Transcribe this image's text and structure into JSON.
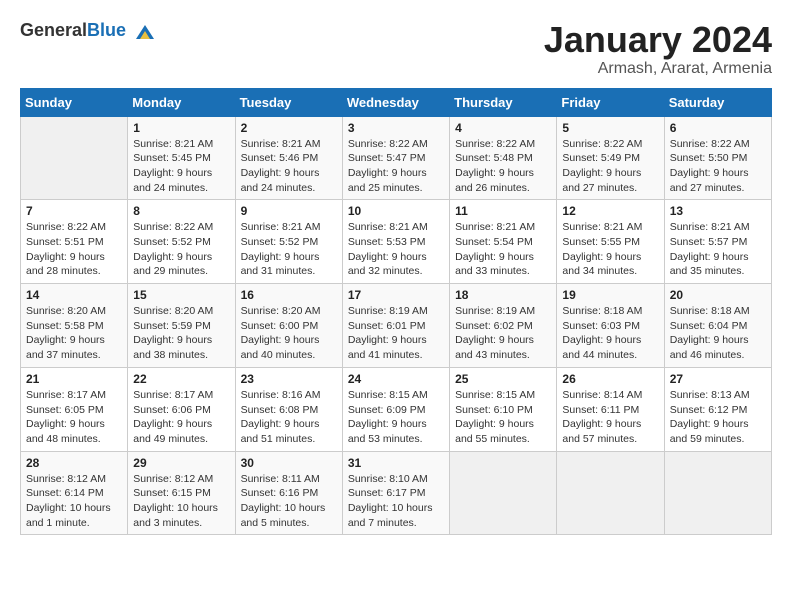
{
  "header": {
    "logo_general": "General",
    "logo_blue": "Blue",
    "month": "January 2024",
    "location": "Armash, Ararat, Armenia"
  },
  "weekdays": [
    "Sunday",
    "Monday",
    "Tuesday",
    "Wednesday",
    "Thursday",
    "Friday",
    "Saturday"
  ],
  "weeks": [
    [
      {
        "day": "",
        "info": ""
      },
      {
        "day": "1",
        "info": "Sunrise: 8:21 AM\nSunset: 5:45 PM\nDaylight: 9 hours\nand 24 minutes."
      },
      {
        "day": "2",
        "info": "Sunrise: 8:21 AM\nSunset: 5:46 PM\nDaylight: 9 hours\nand 24 minutes."
      },
      {
        "day": "3",
        "info": "Sunrise: 8:22 AM\nSunset: 5:47 PM\nDaylight: 9 hours\nand 25 minutes."
      },
      {
        "day": "4",
        "info": "Sunrise: 8:22 AM\nSunset: 5:48 PM\nDaylight: 9 hours\nand 26 minutes."
      },
      {
        "day": "5",
        "info": "Sunrise: 8:22 AM\nSunset: 5:49 PM\nDaylight: 9 hours\nand 27 minutes."
      },
      {
        "day": "6",
        "info": "Sunrise: 8:22 AM\nSunset: 5:50 PM\nDaylight: 9 hours\nand 27 minutes."
      }
    ],
    [
      {
        "day": "7",
        "info": "Sunrise: 8:22 AM\nSunset: 5:51 PM\nDaylight: 9 hours\nand 28 minutes."
      },
      {
        "day": "8",
        "info": "Sunrise: 8:22 AM\nSunset: 5:52 PM\nDaylight: 9 hours\nand 29 minutes."
      },
      {
        "day": "9",
        "info": "Sunrise: 8:21 AM\nSunset: 5:52 PM\nDaylight: 9 hours\nand 31 minutes."
      },
      {
        "day": "10",
        "info": "Sunrise: 8:21 AM\nSunset: 5:53 PM\nDaylight: 9 hours\nand 32 minutes."
      },
      {
        "day": "11",
        "info": "Sunrise: 8:21 AM\nSunset: 5:54 PM\nDaylight: 9 hours\nand 33 minutes."
      },
      {
        "day": "12",
        "info": "Sunrise: 8:21 AM\nSunset: 5:55 PM\nDaylight: 9 hours\nand 34 minutes."
      },
      {
        "day": "13",
        "info": "Sunrise: 8:21 AM\nSunset: 5:57 PM\nDaylight: 9 hours\nand 35 minutes."
      }
    ],
    [
      {
        "day": "14",
        "info": "Sunrise: 8:20 AM\nSunset: 5:58 PM\nDaylight: 9 hours\nand 37 minutes."
      },
      {
        "day": "15",
        "info": "Sunrise: 8:20 AM\nSunset: 5:59 PM\nDaylight: 9 hours\nand 38 minutes."
      },
      {
        "day": "16",
        "info": "Sunrise: 8:20 AM\nSunset: 6:00 PM\nDaylight: 9 hours\nand 40 minutes."
      },
      {
        "day": "17",
        "info": "Sunrise: 8:19 AM\nSunset: 6:01 PM\nDaylight: 9 hours\nand 41 minutes."
      },
      {
        "day": "18",
        "info": "Sunrise: 8:19 AM\nSunset: 6:02 PM\nDaylight: 9 hours\nand 43 minutes."
      },
      {
        "day": "19",
        "info": "Sunrise: 8:18 AM\nSunset: 6:03 PM\nDaylight: 9 hours\nand 44 minutes."
      },
      {
        "day": "20",
        "info": "Sunrise: 8:18 AM\nSunset: 6:04 PM\nDaylight: 9 hours\nand 46 minutes."
      }
    ],
    [
      {
        "day": "21",
        "info": "Sunrise: 8:17 AM\nSunset: 6:05 PM\nDaylight: 9 hours\nand 48 minutes."
      },
      {
        "day": "22",
        "info": "Sunrise: 8:17 AM\nSunset: 6:06 PM\nDaylight: 9 hours\nand 49 minutes."
      },
      {
        "day": "23",
        "info": "Sunrise: 8:16 AM\nSunset: 6:08 PM\nDaylight: 9 hours\nand 51 minutes."
      },
      {
        "day": "24",
        "info": "Sunrise: 8:15 AM\nSunset: 6:09 PM\nDaylight: 9 hours\nand 53 minutes."
      },
      {
        "day": "25",
        "info": "Sunrise: 8:15 AM\nSunset: 6:10 PM\nDaylight: 9 hours\nand 55 minutes."
      },
      {
        "day": "26",
        "info": "Sunrise: 8:14 AM\nSunset: 6:11 PM\nDaylight: 9 hours\nand 57 minutes."
      },
      {
        "day": "27",
        "info": "Sunrise: 8:13 AM\nSunset: 6:12 PM\nDaylight: 9 hours\nand 59 minutes."
      }
    ],
    [
      {
        "day": "28",
        "info": "Sunrise: 8:12 AM\nSunset: 6:14 PM\nDaylight: 10 hours\nand 1 minute."
      },
      {
        "day": "29",
        "info": "Sunrise: 8:12 AM\nSunset: 6:15 PM\nDaylight: 10 hours\nand 3 minutes."
      },
      {
        "day": "30",
        "info": "Sunrise: 8:11 AM\nSunset: 6:16 PM\nDaylight: 10 hours\nand 5 minutes."
      },
      {
        "day": "31",
        "info": "Sunrise: 8:10 AM\nSunset: 6:17 PM\nDaylight: 10 hours\nand 7 minutes."
      },
      {
        "day": "",
        "info": ""
      },
      {
        "day": "",
        "info": ""
      },
      {
        "day": "",
        "info": ""
      }
    ]
  ]
}
